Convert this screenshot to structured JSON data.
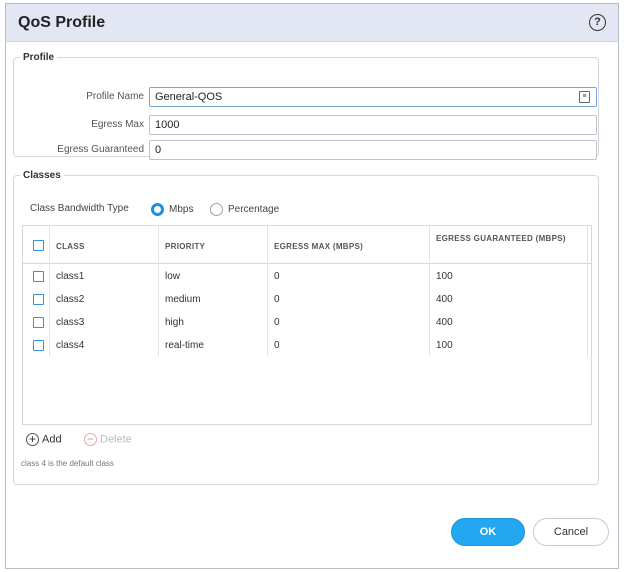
{
  "dialog": {
    "title": "QoS Profile",
    "help_icon": "?"
  },
  "profile": {
    "legend": "Profile",
    "fields": {
      "profile_name": {
        "label": "Profile Name",
        "value": "General-QOS"
      },
      "egress_max": {
        "label": "Egress Max",
        "value": "1000"
      },
      "egress_guaranteed": {
        "label": "Egress Guaranteed",
        "value": "0"
      }
    }
  },
  "classes": {
    "legend": "Classes",
    "bandwidth_type_label": "Class Bandwidth Type",
    "options": [
      {
        "label": "Mbps",
        "selected": true
      },
      {
        "label": "Percentage",
        "selected": false
      }
    ],
    "columns": [
      "CLASS",
      "PRIORITY",
      "EGRESS MAX (MBPS)",
      "EGRESS GUARANTEED (MBPS)"
    ],
    "rows": [
      {
        "class": "class1",
        "priority": "low",
        "egress_max": "0",
        "egress_guaranteed": "100"
      },
      {
        "class": "class2",
        "priority": "medium",
        "egress_max": "0",
        "egress_guaranteed": "400"
      },
      {
        "class": "class3",
        "priority": "high",
        "egress_max": "0",
        "egress_guaranteed": "400"
      },
      {
        "class": "class4",
        "priority": "real-time",
        "egress_max": "0",
        "egress_guaranteed": "100"
      }
    ],
    "add_label": "Add",
    "delete_label": "Delete",
    "note": "class 4 is the default class"
  },
  "buttons": {
    "ok": "OK",
    "cancel": "Cancel"
  },
  "colors": {
    "accent": "#22a7f0",
    "titlebar": "#e3e6f3"
  }
}
